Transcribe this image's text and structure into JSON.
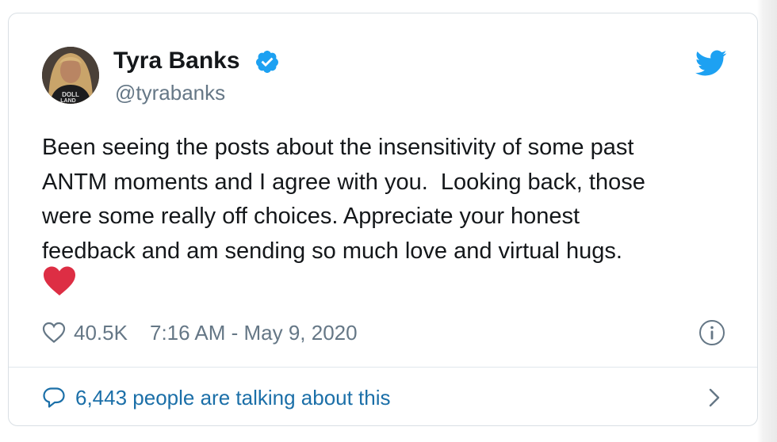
{
  "user": {
    "display_name": "Tyra Banks",
    "handle": "@tyrabanks",
    "verified": true,
    "avatar_text": "DOLL LAND"
  },
  "tweet": {
    "lines": [
      "Been seeing the posts about the insensitivity of some past",
      "ANTM moments and I agree with you.  Looking back, those",
      "were some really off choices. Appreciate your honest",
      "feedback and am sending so much love and virtual hugs."
    ],
    "emoji": "red-heart"
  },
  "meta": {
    "like_count": "40.5K",
    "timestamp": "7:16 AM - May 9, 2020"
  },
  "footer": {
    "talking_text": "6,443 people are talking about this"
  },
  "colors": {
    "text": "#14171a",
    "secondary": "#657786",
    "twitter_blue": "#1da1f2",
    "link_blue": "#1b6fa8",
    "heart_red": "#e0245e"
  },
  "icons": [
    "verified-badge-icon",
    "twitter-bird-icon",
    "heart-emoji",
    "like-icon",
    "info-icon",
    "speech-bubble-icon",
    "chevron-right-icon"
  ]
}
